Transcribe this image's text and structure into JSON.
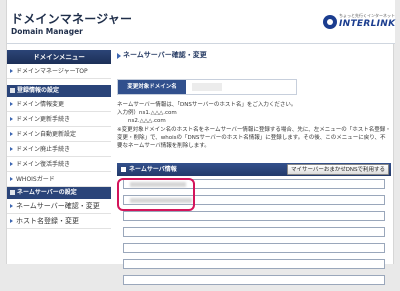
{
  "header": {
    "title": "ドメインマネージャー",
    "subtitle": "Domain Manager",
    "logo_tagline": "ちょっと先行くインターネット",
    "logo_word": "INTERLINK"
  },
  "sidebar": {
    "header": "ドメインメニュー",
    "top_item": "ドメインマネージャーTOP",
    "sections": [
      {
        "title": "登録情報の設定",
        "items": [
          "ドメイン情報変更",
          "ドメイン更新手続き",
          "ドメイン自動更新設定",
          "ドメイン廃止手続き",
          "ドメイン復活手続き",
          "WHOISガード"
        ]
      },
      {
        "title": "ネームサーバーの設定",
        "items": [
          "ネームサーバー確認・変更",
          "ホスト名登録・変更"
        ]
      }
    ]
  },
  "main": {
    "title": "ネームサーバー確認・変更",
    "domain_label": "変更対象ドメイン名",
    "desc_line1": "ネームサーバー情報は、「DNSサーバーのホスト名」をご入力ください。",
    "desc_line2": "入力例）ns1.△△△.com",
    "desc_line3": "ns2.△△△.com",
    "desc_note": "※変更対象ドメイン名のホスト名をネームサーバー情報に登録する場合、先に、左メニューの「ホスト名登録・変更・削除」で、whoisの「DNSサーバーのホスト名情報」に登録します。その後、このメニューに戻り、不要なネームサーバ情報を削除します。",
    "ns_title": "ネームサーバ情報",
    "auto_button": "マイサーバーおまかせDNSで利用する",
    "ns_fields": [
      "",
      "",
      "",
      "",
      "",
      "",
      ""
    ]
  },
  "colors": {
    "nav_dark": "#1c2f57",
    "accent": "#3c66b1",
    "highlight": "#d4145a"
  }
}
